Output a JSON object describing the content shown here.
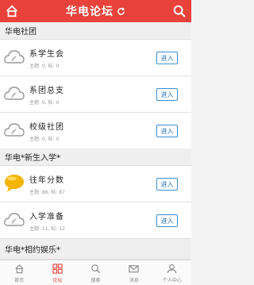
{
  "header": {
    "title": "华电论坛",
    "back_icon": "home-icon",
    "refresh_icon": "refresh-icon",
    "search_icon": "search-icon",
    "color": "#e8423a"
  },
  "sections": [
    {
      "title": "华电社团",
      "items": [
        {
          "name": "系学生会",
          "meta": "主题: 0, 帖: 0",
          "button": "进入",
          "icon": "cloud-grey-icon"
        },
        {
          "name": "系团总支",
          "meta": "主题: 0, 帖: 0",
          "button": "进入",
          "icon": "cloud-grey-icon"
        },
        {
          "name": "校级社团",
          "meta": "主题: 0, 帖: 0",
          "button": "进入",
          "icon": "cloud-grey-icon"
        }
      ]
    },
    {
      "title": "华电*新生入学*",
      "items": [
        {
          "name": "往年分数",
          "meta": "主题: 86, 帖: 87",
          "button": "进入",
          "icon": "chat-bubble-yellow-icon"
        },
        {
          "name": "入学准备",
          "meta": "主题: 11, 帖: 12",
          "button": "进入",
          "icon": "cloud-grey-icon"
        }
      ]
    },
    {
      "title": "华电*相约娱乐*",
      "items": []
    }
  ],
  "tabbar": {
    "items": [
      {
        "label": "首页",
        "icon": "home-icon"
      },
      {
        "label": "论坛",
        "icon": "grid-icon",
        "active": true
      },
      {
        "label": "搜索",
        "icon": "search-icon"
      },
      {
        "label": "消息",
        "icon": "mail-icon"
      },
      {
        "label": "个人中心",
        "icon": "person-icon"
      }
    ]
  }
}
